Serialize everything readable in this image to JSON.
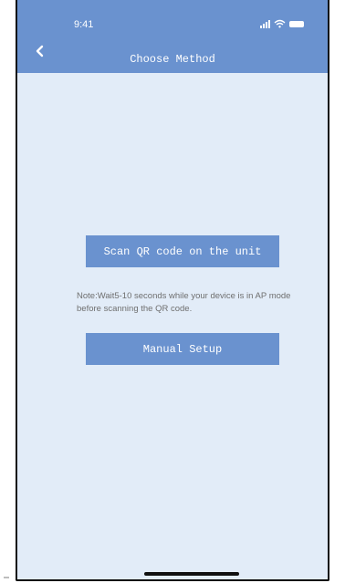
{
  "status_bar": {
    "time": "9:41"
  },
  "header": {
    "title": "Choose Method",
    "back_icon": "chevron-left-icon"
  },
  "main": {
    "scan_button_label": "Scan QR code on the unit",
    "note_text": "Note:Wait5-10 seconds while your device is in AP mode before scanning the QR code.",
    "manual_button_label": "Manual Setup"
  },
  "colors": {
    "header_bg": "#6a92cf",
    "page_bg": "#e2ecf8",
    "button_bg": "#6a92cf",
    "note_text": "#6f6f6f"
  }
}
